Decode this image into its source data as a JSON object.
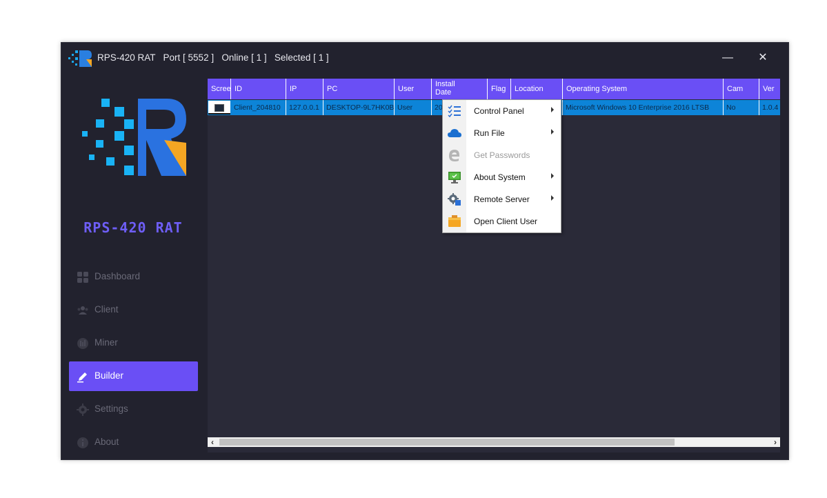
{
  "window": {
    "title": "RPS-420 RAT   Port [ 5552 ]   Online [ 1 ]   Selected [ 1 ]",
    "minimize_label": "—",
    "close_label": "✕"
  },
  "sidebar": {
    "logo_text": "RPS-420 RAT",
    "items": [
      {
        "label": "Dashboard",
        "icon": "dashboard-icon"
      },
      {
        "label": "Client",
        "icon": "users-icon"
      },
      {
        "label": "Miner",
        "icon": "miner-icon"
      },
      {
        "label": "Builder",
        "icon": "builder-icon",
        "active": true
      },
      {
        "label": "Settings",
        "icon": "gear-icon"
      },
      {
        "label": "About",
        "icon": "info-icon"
      }
    ]
  },
  "grid": {
    "columns": [
      "Scree",
      "ID",
      "IP",
      "PC",
      "User",
      "Install Date",
      "Flag",
      "Location",
      "Operating System",
      "Cam",
      "Ver"
    ],
    "install_date_lines": [
      "Install",
      "Date"
    ],
    "row": {
      "id": "Client_204810",
      "ip": "127.0.0.1",
      "pc": "DESKTOP-9L7HK0B",
      "user": "User",
      "install_date": "20",
      "os": "Microsoft Windows 10 Enterprise 2016 LTSB",
      "cam": "No",
      "ver": "1.0.4"
    }
  },
  "context_menu": {
    "items": [
      {
        "label": "Control Panel",
        "icon": "checklist-icon",
        "submenu": true
      },
      {
        "label": "Run File",
        "icon": "cloud-icon",
        "submenu": true
      },
      {
        "label": "Get Passwords",
        "icon": "edge-browser-icon",
        "disabled": true
      },
      {
        "label": "About System",
        "icon": "monitor-icon",
        "submenu": true
      },
      {
        "label": "Remote Server",
        "icon": "server-gear-icon",
        "submenu": true
      },
      {
        "label": "Open Client User",
        "icon": "folder-user-icon"
      }
    ]
  },
  "colors": {
    "accent": "#6a4ff5",
    "selection": "#0d84d8",
    "background": "#22222e",
    "logo_blue": "#1aa8f0",
    "logo_orange": "#f5a623"
  }
}
